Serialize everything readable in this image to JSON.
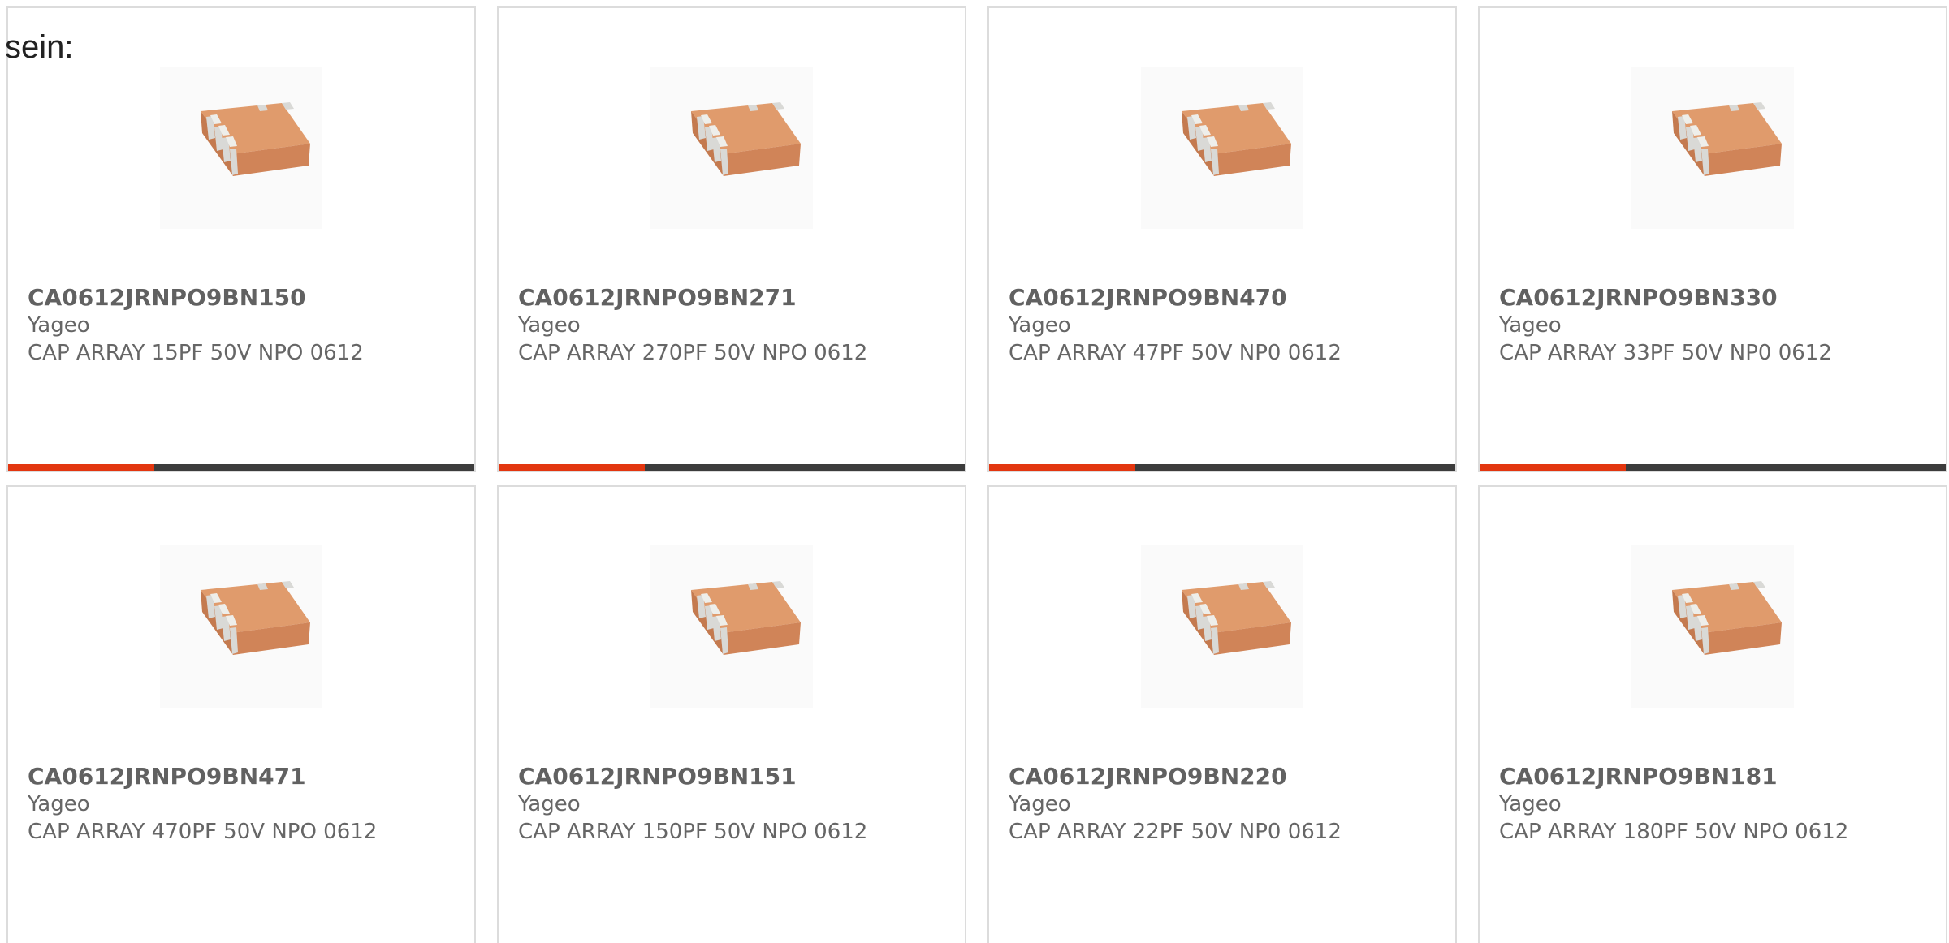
{
  "intro_text": "sein:",
  "colors": {
    "accent": "#e3360f",
    "bar": "#3c3c3c",
    "chip_body": "#d4875a",
    "chip_terminal": "#d9d9d6"
  },
  "products": [
    {
      "part": "CA0612JRNPO9BN150",
      "brand": "Yageo",
      "desc": "CAP ARRAY 15PF 50V NPO 0612",
      "image_icon": "capacitor-array-chip-icon"
    },
    {
      "part": "CA0612JRNPO9BN271",
      "brand": "Yageo",
      "desc": "CAP ARRAY 270PF 50V NPO 0612",
      "image_icon": "capacitor-array-chip-icon"
    },
    {
      "part": "CA0612JRNPO9BN470",
      "brand": "Yageo",
      "desc": "CAP ARRAY 47PF 50V NP0 0612",
      "image_icon": "capacitor-array-chip-icon"
    },
    {
      "part": "CA0612JRNPO9BN330",
      "brand": "Yageo",
      "desc": "CAP ARRAY 33PF 50V NP0 0612",
      "image_icon": "capacitor-array-chip-icon"
    },
    {
      "part": "CA0612JRNPO9BN471",
      "brand": "Yageo",
      "desc": "CAP ARRAY 470PF 50V NPO 0612",
      "image_icon": "capacitor-array-chip-icon"
    },
    {
      "part": "CA0612JRNPO9BN151",
      "brand": "Yageo",
      "desc": "CAP ARRAY 150PF 50V NPO 0612",
      "image_icon": "capacitor-array-chip-icon"
    },
    {
      "part": "CA0612JRNPO9BN220",
      "brand": "Yageo",
      "desc": "CAP ARRAY 22PF 50V NP0 0612",
      "image_icon": "capacitor-array-chip-icon"
    },
    {
      "part": "CA0612JRNPO9BN181",
      "brand": "Yageo",
      "desc": "CAP ARRAY 180PF 50V NPO 0612",
      "image_icon": "capacitor-array-chip-icon"
    }
  ]
}
